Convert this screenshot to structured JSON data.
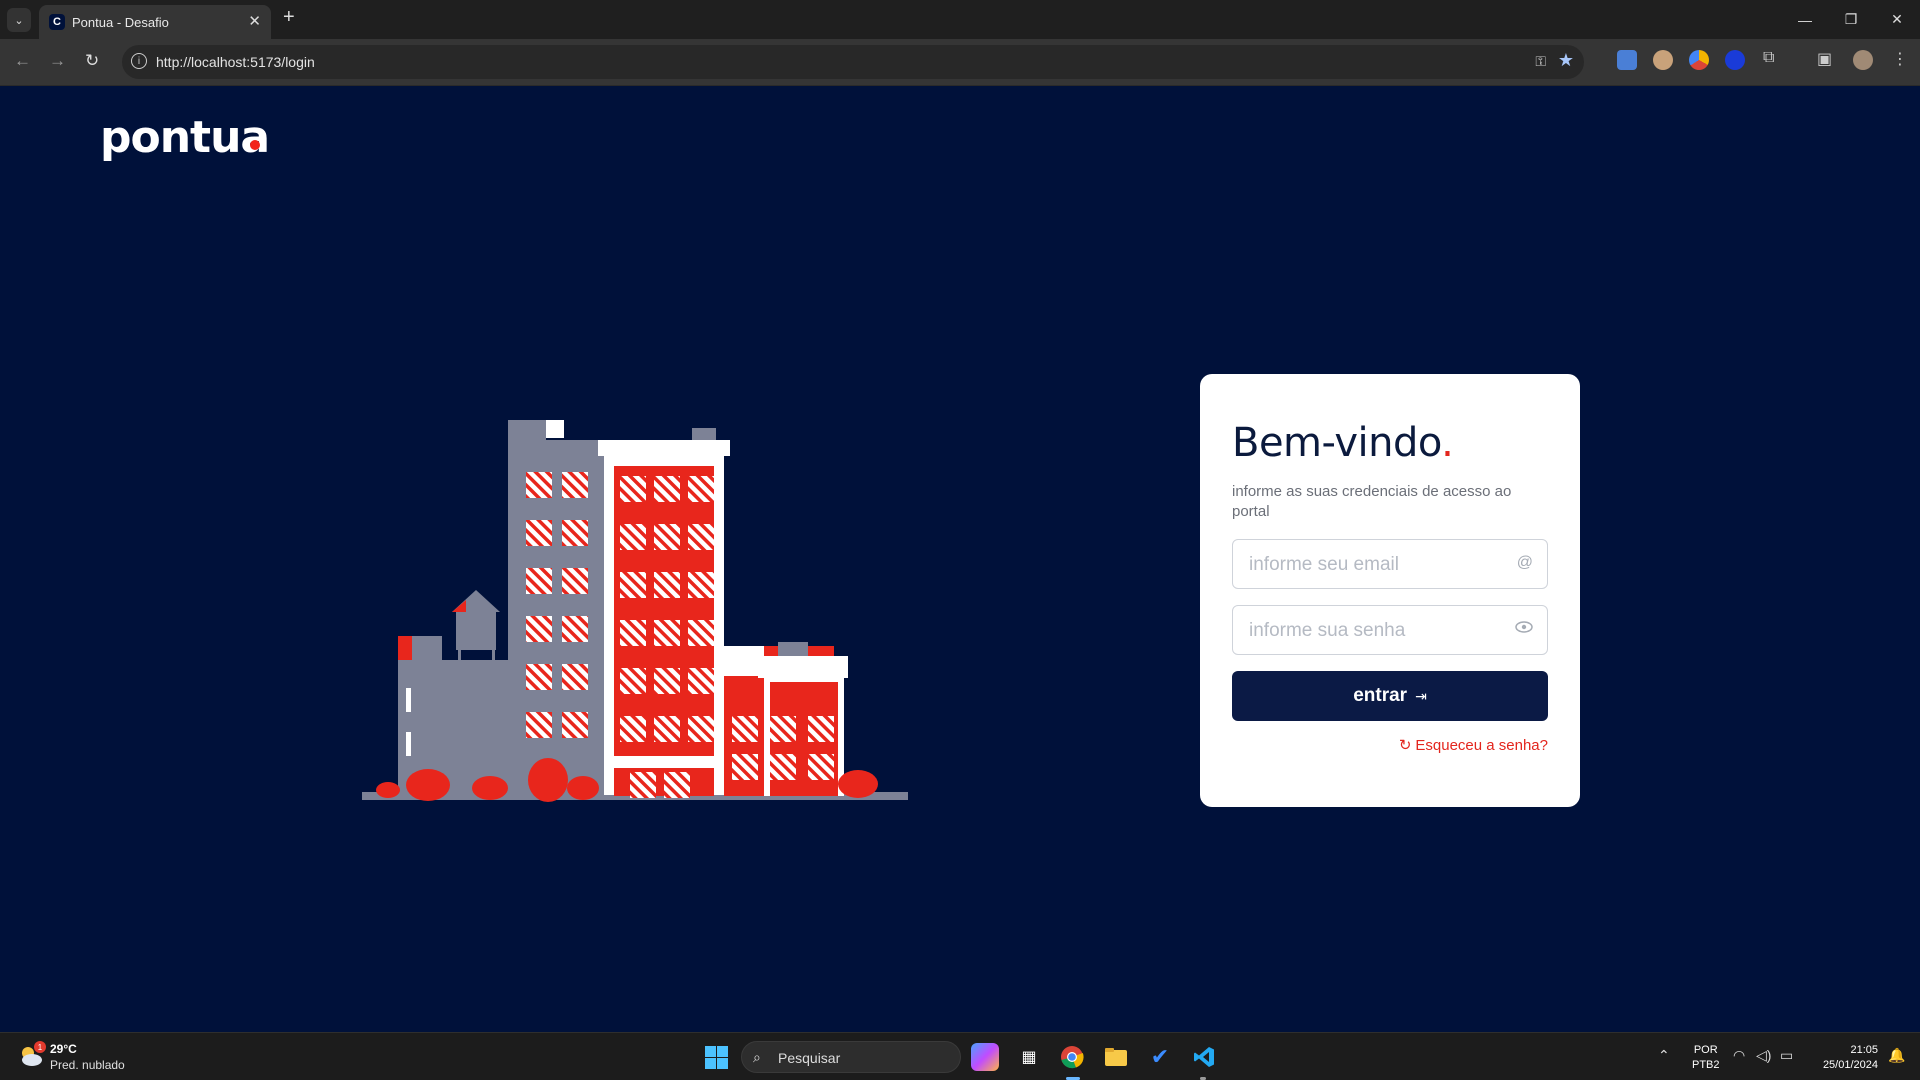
{
  "browser": {
    "tab_title": "Pontua - Desafio",
    "url": "http://localhost:5173/login",
    "tab_close": "✕",
    "new_tab": "+",
    "window_controls": [
      "—",
      "❐",
      "✕"
    ]
  },
  "page": {
    "logo_text": "pontua",
    "brand_red": "#e3261e",
    "background": "#00113a"
  },
  "login": {
    "title": "Bem-vindo",
    "title_dot": ".",
    "subtitle": "informe as suas credenciais de acesso ao portal",
    "email_placeholder": "informe seu email",
    "email_icon": "@",
    "password_placeholder": "informe sua senha",
    "submit_label": "entrar",
    "forgot_label": "Esqueceu a senha?"
  },
  "taskbar": {
    "weather_temp": "29°C",
    "weather_desc": "Pred. nublado",
    "weather_badge": "1",
    "search_label": "Pesquisar",
    "lang_1": "POR",
    "lang_2": "PTB2",
    "time": "21:05",
    "date": "25/01/2024"
  }
}
